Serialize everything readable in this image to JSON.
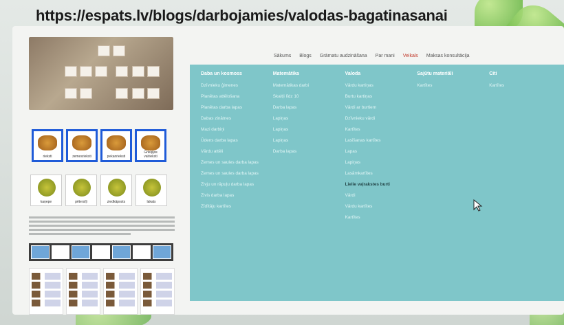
{
  "url_banner": "https://espats.lv/blogs/darbojamies/valodas-bagatinasanai",
  "nav": {
    "items": [
      "Sākums",
      "Blogs",
      "Grāmatu audzināšana",
      "Par mani",
      "Veikals",
      "Maksas konsultācija"
    ],
    "active_index": 4
  },
  "left_images": {
    "food_cards": [
      "rieksti",
      "zemesrieksti",
      "pekanrieksti",
      "Grieķijas valrieksti"
    ],
    "plant_cards": [
      "kaņepe",
      "pētersīļi",
      "ziedkāposts",
      "lakats"
    ]
  },
  "mega_menu": {
    "columns": [
      {
        "title": "Daba un kosmoss",
        "items": [
          "Dzīvnieku ģimenes",
          "Planētas attēlošana",
          "Planētas darba lapas",
          "Dabas zinātnes",
          "Mazi darbiņi",
          "Ūdens darba lapas",
          "Vārdu attēli",
          "Zemes un saules darba lapas",
          "Zemes un saules darba lapas",
          "Zivju un rāpuļu darba lapas",
          "Zivis darba lapas",
          "Zīdītāju kartītes"
        ]
      },
      {
        "title": "Matemātika",
        "items": [
          "Matemātikas darbi",
          "Skaitļi līdz 10",
          "Darba lapas",
          "Lapiņas",
          "Lapiņas",
          "Lapiņas",
          "Darba lapas"
        ]
      },
      {
        "title": "Valoda",
        "items": [
          "Vārdu kartiņas",
          "Burtu kartiņas",
          "Vārdi ar burtiem",
          "Dzīvnieku vārdi",
          "Kartītes",
          "Lasīšanas kartītes",
          "Lapas",
          "Lapiņas",
          "Lasāmkartītes",
          "Lielie vaļrakstes burti",
          "Vārdi",
          "Vārdu kartītes",
          "Kartītes"
        ]
      },
      {
        "title": "Sajūtu materiāli",
        "items": [
          "Kartītes"
        ]
      },
      {
        "title": "Citi",
        "items": [
          "Kartītes"
        ]
      }
    ],
    "highlight_item": "Lielie vaļrakstes burti"
  }
}
